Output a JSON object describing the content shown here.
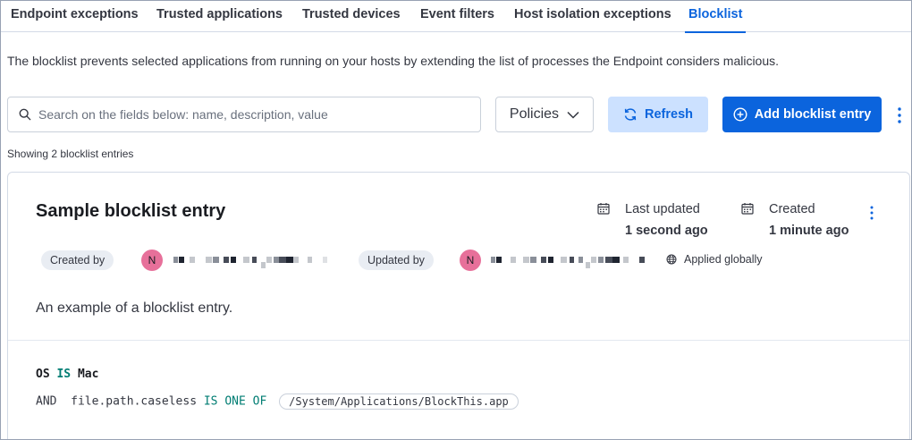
{
  "tabs": [
    {
      "label": "Endpoint exceptions"
    },
    {
      "label": "Trusted applications"
    },
    {
      "label": "Trusted devices"
    },
    {
      "label": "Event filters"
    },
    {
      "label": "Host isolation exceptions"
    },
    {
      "label": "Blocklist",
      "active": true
    }
  ],
  "description": "The blocklist prevents selected applications from running on your hosts by extending the list of processes the Endpoint considers malicious.",
  "search": {
    "placeholder": "Search on the fields below: name, description, value",
    "value": ""
  },
  "toolbar": {
    "policies_label": "Policies",
    "refresh_label": "Refresh",
    "add_label": "Add blocklist entry"
  },
  "showing_text": "Showing 2 blocklist entries",
  "entry": {
    "title": "Sample blocklist entry",
    "last_updated_label": "Last updated",
    "last_updated_value": "1 second ago",
    "created_label": "Created",
    "created_value": "1 minute ago",
    "created_by_label": "Created by",
    "updated_by_label": "Updated by",
    "created_by_avatar": "N",
    "updated_by_avatar": "N",
    "applied_label": "Applied globally",
    "description": "An example of a blocklist entry.",
    "conditions": {
      "os_keyword": "OS",
      "os_operator": "IS",
      "os_value": "Mac",
      "and_keyword": "AND",
      "field": "file.path.caseless",
      "operator": "IS ONE OF",
      "value": "/System/Applications/BlockThis.app"
    }
  },
  "colors": {
    "primary": "#0b64dd",
    "refresh_bg": "#cce1ff",
    "avatar": "#e7709a",
    "keyword_green": "#017d73"
  }
}
